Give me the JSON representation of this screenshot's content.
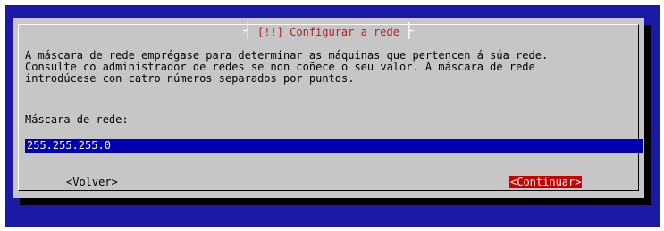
{
  "dialog": {
    "title": "[!!] Configurar a rede",
    "description": "A máscara de rede emprégase para determinar as máquinas que pertencen á súa rede.\nConsulte co administrador de redes se non coñece o seu valor. A máscara de rede\nintrodúcese con catro números separados por puntos.",
    "field_label": "Máscara de rede:",
    "netmask_value": "255.255.255.0",
    "back_label": "<Volver>",
    "continue_label": "<Continuar>"
  },
  "colors": {
    "screen_background": "#1a1aa6",
    "dialog_background": "#c6c6c6",
    "title_text": "#b22222",
    "input_background": "#0000b0",
    "focused_button_background": "#cc0000"
  }
}
